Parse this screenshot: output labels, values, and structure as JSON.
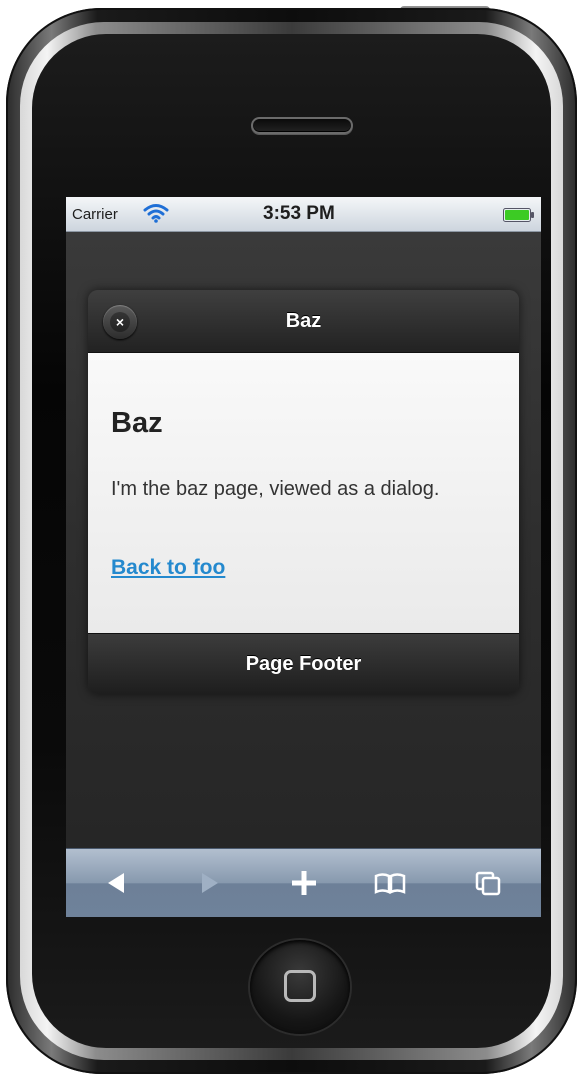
{
  "statusbar": {
    "carrier": "Carrier",
    "time": "3:53 PM",
    "wifi_icon": "wifi-icon",
    "battery_icon": "battery-icon"
  },
  "dialog": {
    "title": "Baz",
    "close_icon": "close-icon",
    "close_glyph": "×",
    "heading": "Baz",
    "text": "I'm the baz page, viewed as a dialog.",
    "link_label": "Back to foo",
    "footer": "Page Footer"
  },
  "toolbar": {
    "items": [
      "back-icon",
      "forward-icon",
      "add-icon",
      "bookmarks-icon",
      "pages-icon"
    ]
  },
  "colors": {
    "link": "#2489ce",
    "statusbar": "#cdd5de",
    "toolbar": "#8799ae",
    "header": "#2a2a2a"
  }
}
